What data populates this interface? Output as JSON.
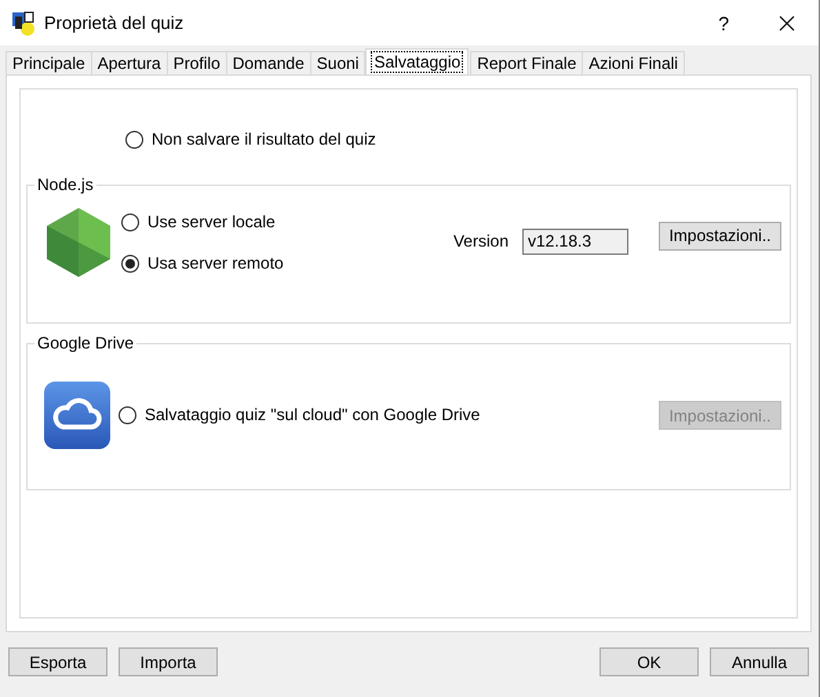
{
  "window": {
    "title": "Proprietà del quiz",
    "help": "?"
  },
  "tabs": [
    {
      "label": "Principale",
      "selected": false
    },
    {
      "label": "Apertura",
      "selected": false
    },
    {
      "label": "Profilo",
      "selected": false
    },
    {
      "label": "Domande",
      "selected": false
    },
    {
      "label": "Suoni",
      "selected": false
    },
    {
      "label": "Salvataggio",
      "selected": true
    },
    {
      "label": "Report Finale",
      "selected": false
    },
    {
      "label": "Azioni Finali",
      "selected": false
    }
  ],
  "no_save_option": {
    "label": "Non salvare il risultato del quiz",
    "selected": false
  },
  "nodejs_group": {
    "title": "Node.js",
    "options": [
      {
        "label": "Use server locale",
        "selected": false
      },
      {
        "label": "Usa server remoto",
        "selected": true
      }
    ],
    "version_label": "Version",
    "version_value": "v12.18.3",
    "settings_button": {
      "label": "Impostazioni..",
      "disabled": false
    }
  },
  "google_drive_group": {
    "title": "Google Drive",
    "option": {
      "label": "Salvataggio quiz \"sul cloud\" con Google Drive",
      "selected": false
    },
    "settings_button": {
      "label": "Impostazioni..",
      "disabled": true
    }
  },
  "footer": {
    "left_buttons": [
      {
        "label": "Esporta"
      },
      {
        "label": "Importa"
      }
    ],
    "right_buttons": [
      {
        "label": "OK"
      },
      {
        "label": "Annulla"
      }
    ]
  }
}
